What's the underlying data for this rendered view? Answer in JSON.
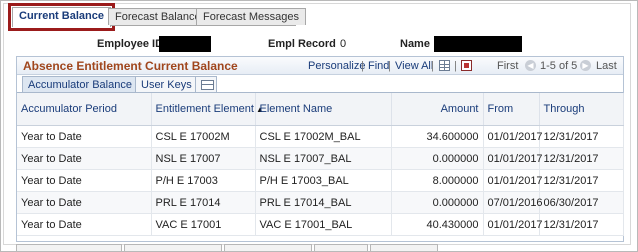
{
  "page_tabs": [
    {
      "label": "Current Balance",
      "active": true
    },
    {
      "label": "Forecast Balance",
      "active": false
    },
    {
      "label": "Forecast Messages",
      "active": false
    }
  ],
  "header": {
    "employee_id_label": "Employee ID",
    "empl_record_label": "Empl Record",
    "empl_record_value": "0",
    "name_label": "Name"
  },
  "grid": {
    "title": "Absence Entitlement Current Balance",
    "nav": {
      "personalize": "Personalize",
      "find": "Find",
      "view_all": "View All",
      "sep": "|",
      "first": "First",
      "range": "1-5 of 5",
      "last": "Last"
    },
    "tabs": [
      {
        "label": "Accumulator Balance",
        "active": true
      },
      {
        "label": "User Keys",
        "active": false
      }
    ],
    "columns": [
      "Accumulator Period",
      "Entitlement Element",
      "Element Name",
      "Amount",
      "From",
      "Through"
    ],
    "sorted_column": "Entitlement Element",
    "rows": [
      [
        "Year to Date",
        "CSL E 17002M",
        "CSL E 17002M_BAL",
        "34.600000",
        "01/01/2017",
        "12/31/2017"
      ],
      [
        "Year to Date",
        "NSL E 17007",
        "NSL E 17007_BAL",
        "0.000000",
        "01/01/2017",
        "12/31/2017"
      ],
      [
        "Year to Date",
        "P/H E 17003",
        "P/H E 17003_BAL",
        "8.000000",
        "01/01/2017",
        "12/31/2017"
      ],
      [
        "Year to Date",
        "PRL E 17014",
        "PRL E 17014_BAL",
        "0.000000",
        "07/01/2016",
        "06/30/2017"
      ],
      [
        "Year to Date",
        "VAC E 17001",
        "VAC E 17001_BAL",
        "40.430000",
        "01/01/2017",
        "12/31/2017"
      ]
    ]
  },
  "colors": {
    "active_tab_highlight": "#9b1b1b",
    "grid_title": "#a0461d",
    "link": "#1a3c7a",
    "redaction": "#000000"
  }
}
